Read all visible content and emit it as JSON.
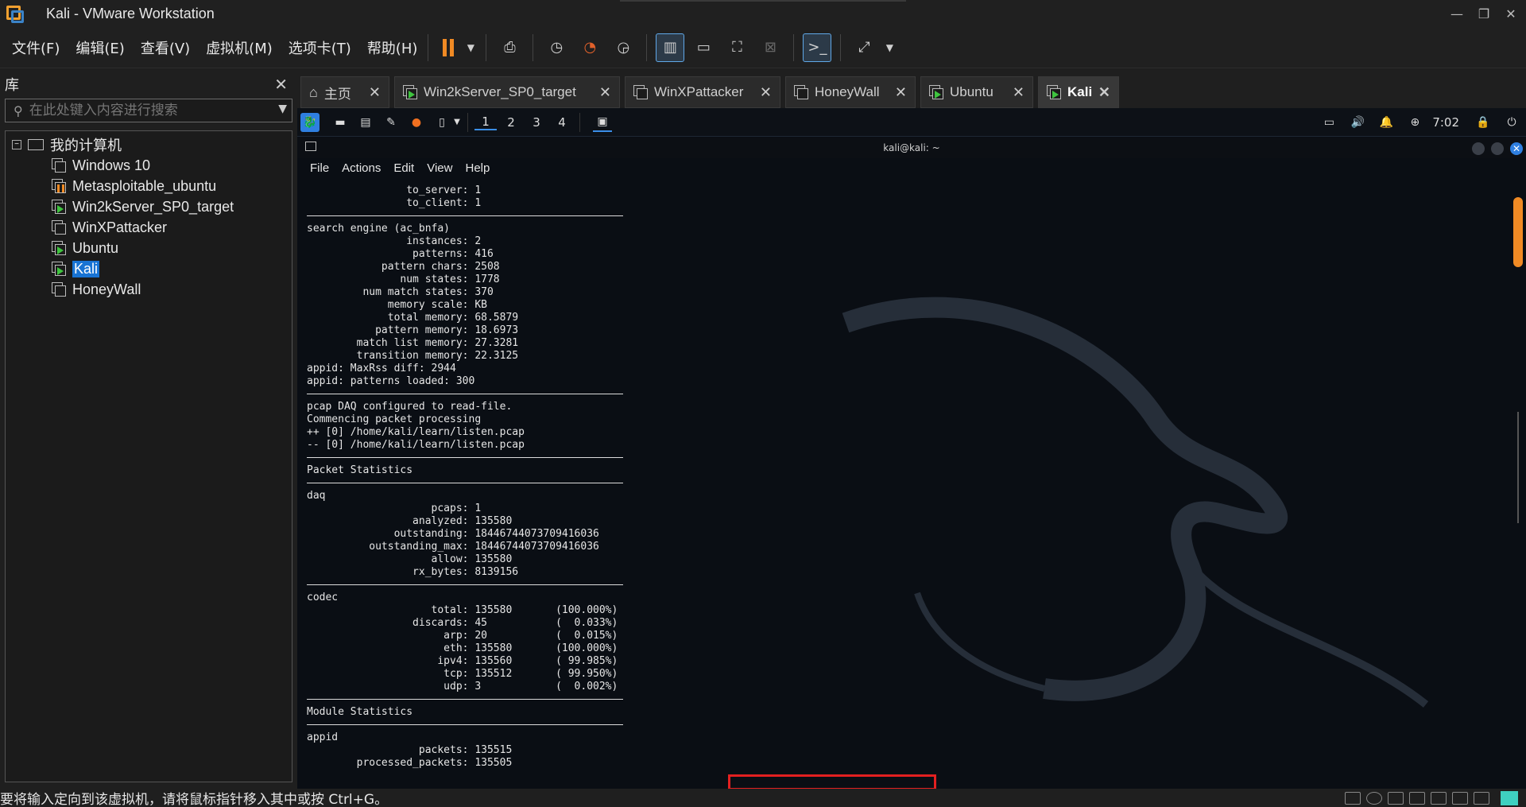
{
  "window": {
    "title": "Kali - VMware Workstation"
  },
  "menu": {
    "items": [
      "文件(F)",
      "编辑(E)",
      "查看(V)",
      "虚拟机(M)",
      "选项卡(T)",
      "帮助(H)"
    ]
  },
  "library": {
    "title": "库",
    "search_placeholder": "在此处键入内容进行搜索",
    "root": "我的计算机",
    "vms": [
      {
        "name": "Windows 10",
        "state": "off"
      },
      {
        "name": "Metasploitable_ubuntu",
        "state": "paused"
      },
      {
        "name": "Win2kServer_SP0_target",
        "state": "running"
      },
      {
        "name": "WinXPattacker",
        "state": "off"
      },
      {
        "name": "Ubuntu",
        "state": "running"
      },
      {
        "name": "Kali",
        "state": "running",
        "selected": true
      },
      {
        "name": "HoneyWall",
        "state": "off"
      }
    ]
  },
  "tabs": [
    {
      "label": "主页"
    },
    {
      "label": "Win2kServer_SP0_target"
    },
    {
      "label": "WinXPattacker"
    },
    {
      "label": "HoneyWall"
    },
    {
      "label": "Ubuntu"
    },
    {
      "label": "Kali",
      "active": true
    }
  ],
  "kali": {
    "workspaces": [
      "1",
      "2",
      "3",
      "4"
    ],
    "clock": "7:02",
    "terminal_title": "kali@kali: ~",
    "terminal_menu": [
      "File",
      "Actions",
      "Edit",
      "View",
      "Help"
    ]
  },
  "terminal_lines": [
    "                to_server: 1",
    "                to_client: 1",
    "---",
    "search engine (ac_bnfa)",
    "                instances: 2",
    "                 patterns: 416",
    "            pattern chars: 2508",
    "               num states: 1778",
    "         num match states: 370",
    "             memory scale: KB",
    "             total memory: 68.5879",
    "           pattern memory: 18.6973",
    "        match list memory: 27.3281",
    "        transition memory: 22.3125",
    "appid: MaxRss diff: 2944",
    "appid: patterns loaded: 300",
    "---",
    "pcap DAQ configured to read-file.",
    "Commencing packet processing",
    "++ [0] /home/kali/learn/listen.pcap",
    "-- [0] /home/kali/learn/listen.pcap",
    "---",
    "Packet Statistics",
    "---",
    "daq",
    "                    pcaps: 1",
    "                 analyzed: 135580",
    "              outstanding: 18446744073709416036",
    "          outstanding_max: 18446744073709416036",
    "                    allow: 135580",
    "                 rx_bytes: 8139156",
    "---",
    "codec",
    "                    total: 135580       (100.000%)",
    "                 discards: 45           (  0.033%)",
    "                      arp: 20           (  0.015%)",
    "                      eth: 135580       (100.000%)",
    "                     ipv4: 135560       ( 99.985%)",
    "                      tcp: 135512       ( 99.950%)",
    "                      udp: 3            (  0.002%)",
    "---",
    "Module Statistics",
    "---",
    "appid",
    "                  packets: 135515",
    "        processed_packets: 135505"
  ],
  "status": {
    "text": "要将输入定向到该虚拟机，请将鼠标指针移入其中或按 Ctrl+G。"
  },
  "colors": {
    "accent": "#f08a24",
    "selection": "#1873d3",
    "running": "#3fc43f",
    "highlight": "#e32020"
  }
}
